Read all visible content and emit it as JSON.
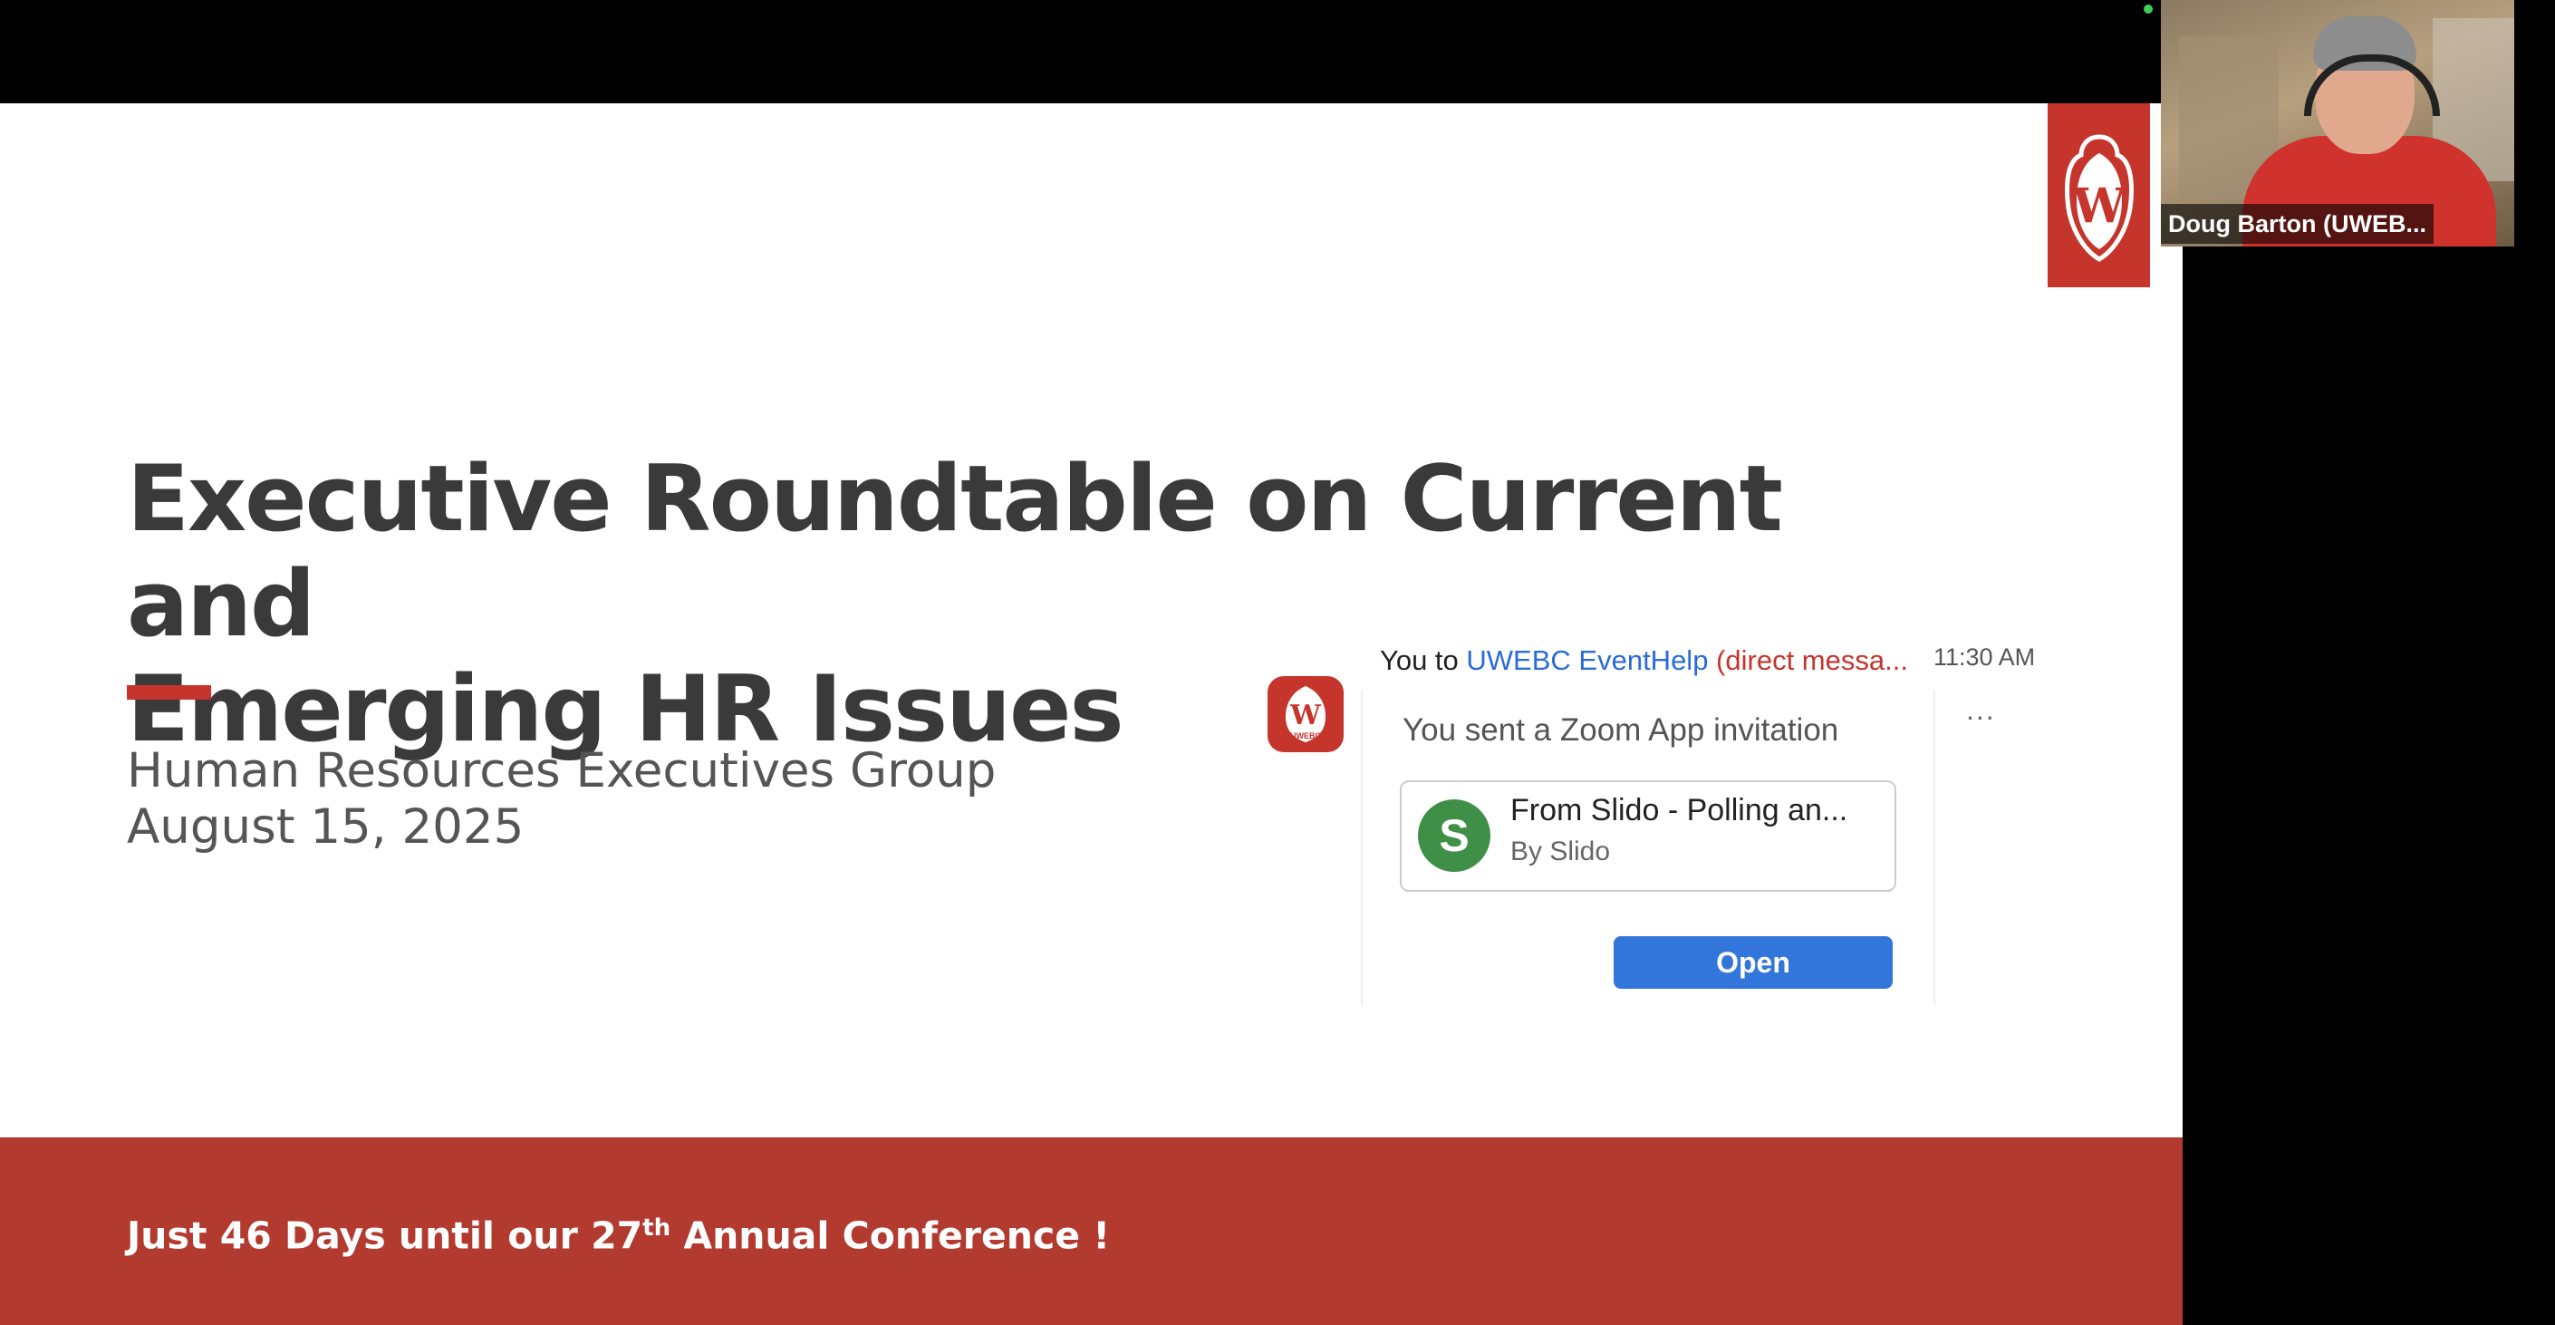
{
  "slide": {
    "title_line1": "Executive Roundtable on Current and",
    "title_line2": "Emerging HR Issues",
    "subtitle": "Human Resources Executives Group",
    "date": "August 15, 2025",
    "footer_pre": "Just 46 Days until our 27",
    "footer_sup": "th",
    "footer_post": " Annual Conference !",
    "crest_letter": "W",
    "accent_color": "#c5352c"
  },
  "chat": {
    "sender": "You to ",
    "recipient": "UWEBC EventHelp",
    "dm_note": " (direct messa...",
    "time": "11:30 AM",
    "more": "...",
    "message": "You sent a Zoom App invitation",
    "avatar_letter": "W",
    "avatar_caption": "UWEBC",
    "app": {
      "icon_letter": "S",
      "name": "From Slido - Polling an...",
      "by": "By Slido"
    },
    "open_label": "Open"
  },
  "video": {
    "participant_name": "Doug Barton (UWEB..."
  }
}
